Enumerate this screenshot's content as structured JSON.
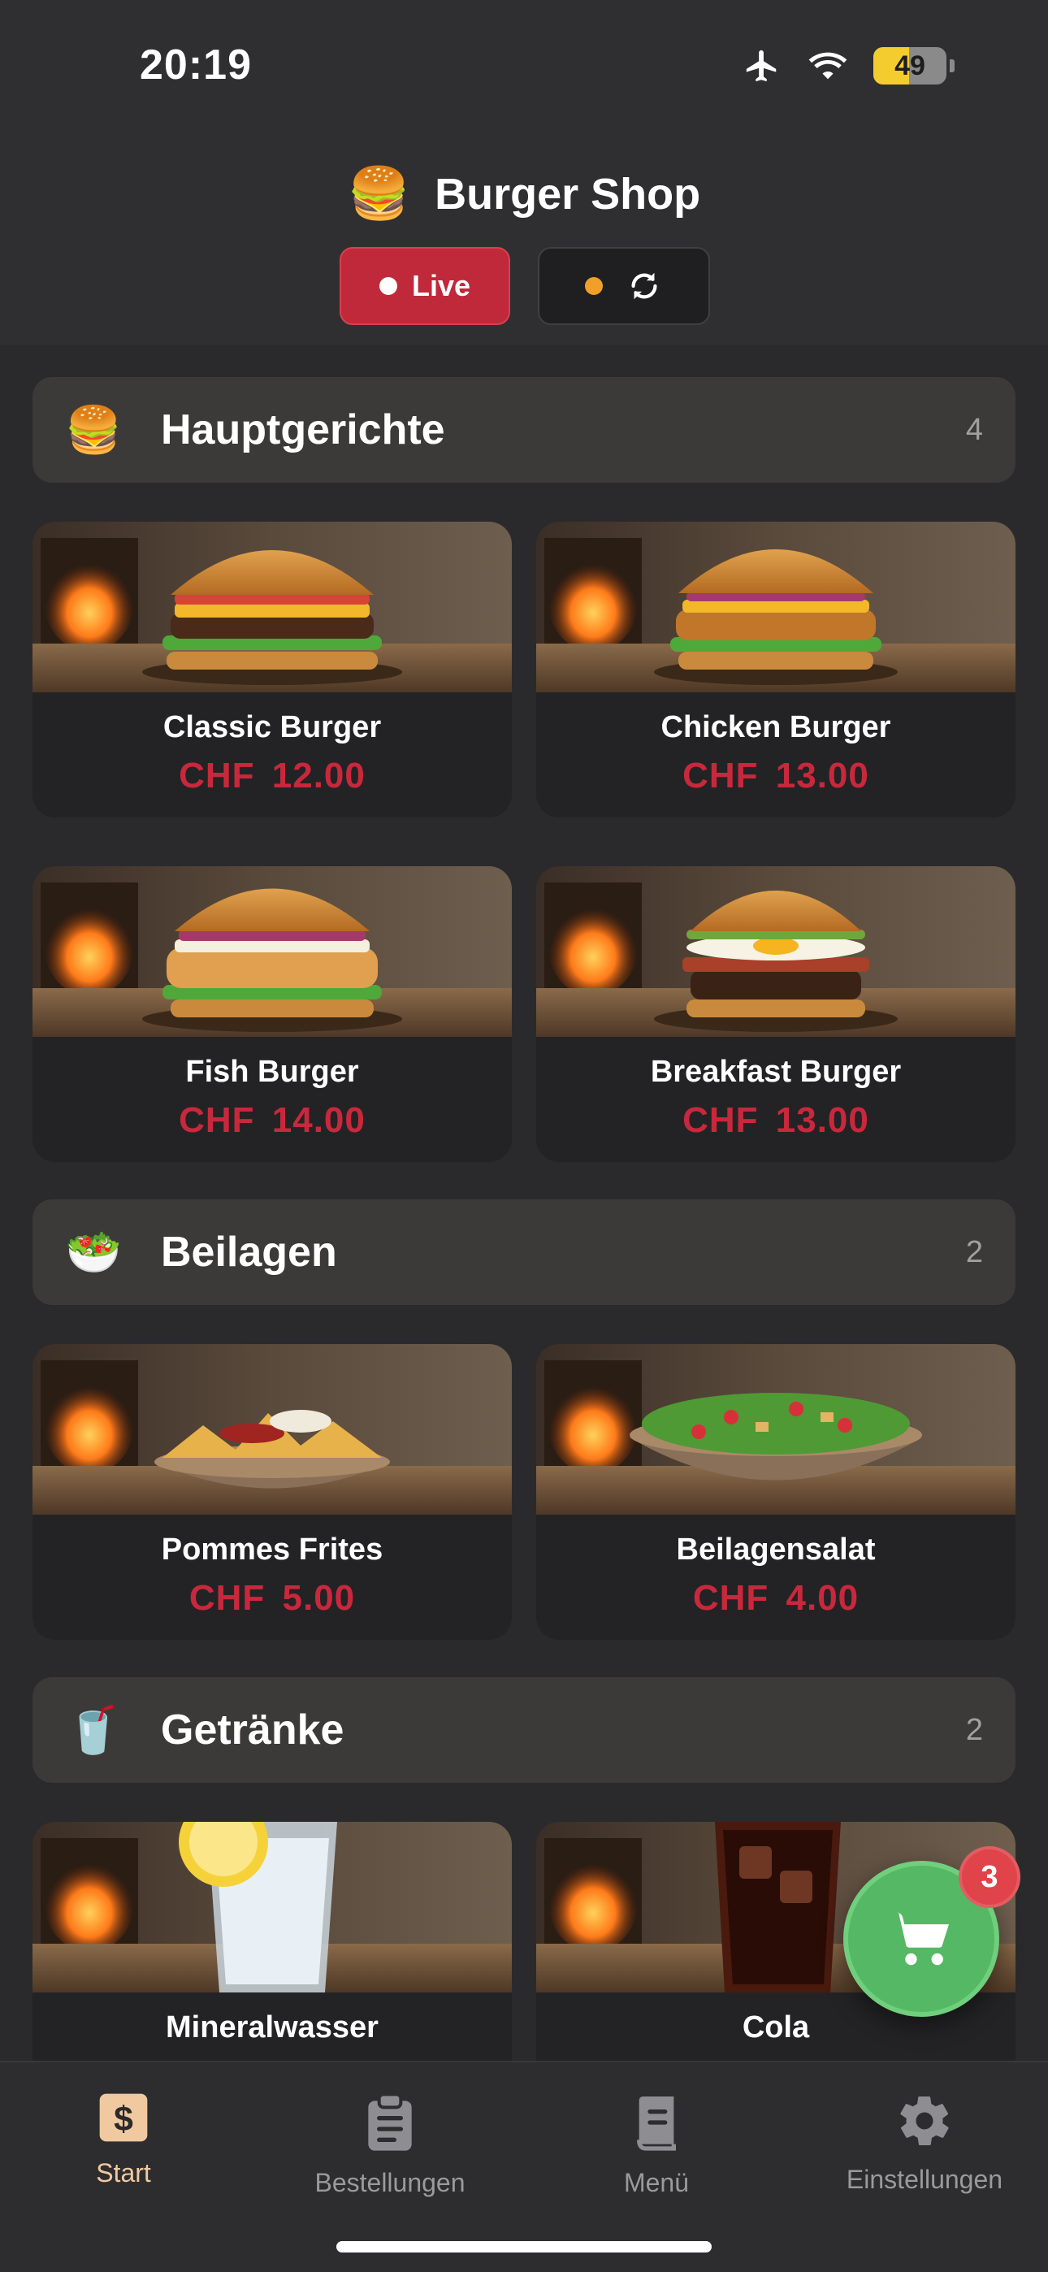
{
  "status_bar": {
    "time": "20:19",
    "battery": "49"
  },
  "header": {
    "title": "Burger Shop",
    "title_icon": "🍔",
    "live_label": "Live",
    "sync_icon": "refresh-icon"
  },
  "categories": [
    {
      "title": "Hauptgerichte",
      "icon": "🍔",
      "count": "4",
      "items": [
        {
          "name": "Classic Burger",
          "price": "CHF 12.00"
        },
        {
          "name": "Chicken Burger",
          "price": "CHF 13.00"
        },
        {
          "name": "Fish Burger",
          "price": "CHF 14.00"
        },
        {
          "name": "Breakfast Burger",
          "price": "CHF 13.00"
        }
      ]
    },
    {
      "title": "Beilagen",
      "icon": "🥗",
      "count": "2",
      "items": [
        {
          "name": "Pommes Frites",
          "price": "CHF 5.00"
        },
        {
          "name": "Beilagensalat",
          "price": "CHF 4.00"
        }
      ]
    },
    {
      "title": "Getränke",
      "icon": "🥤",
      "count": "2",
      "items": [
        {
          "name": "Mineralwasser",
          "price": ""
        },
        {
          "name": "Cola",
          "price": ""
        }
      ]
    }
  ],
  "cart": {
    "count": "3"
  },
  "tabs": [
    {
      "label": "Start",
      "icon": "dollar-icon",
      "active": true
    },
    {
      "label": "Bestellungen",
      "icon": "clipboard-icon",
      "active": false
    },
    {
      "label": "Menü",
      "icon": "menu-book-icon",
      "active": false
    },
    {
      "label": "Einstellungen",
      "icon": "gear-icon",
      "active": false
    }
  ],
  "colors": {
    "accent": "#c9283c",
    "live": "#c0293a",
    "cart": "#55b864",
    "active_tab": "#f0c9a0"
  }
}
